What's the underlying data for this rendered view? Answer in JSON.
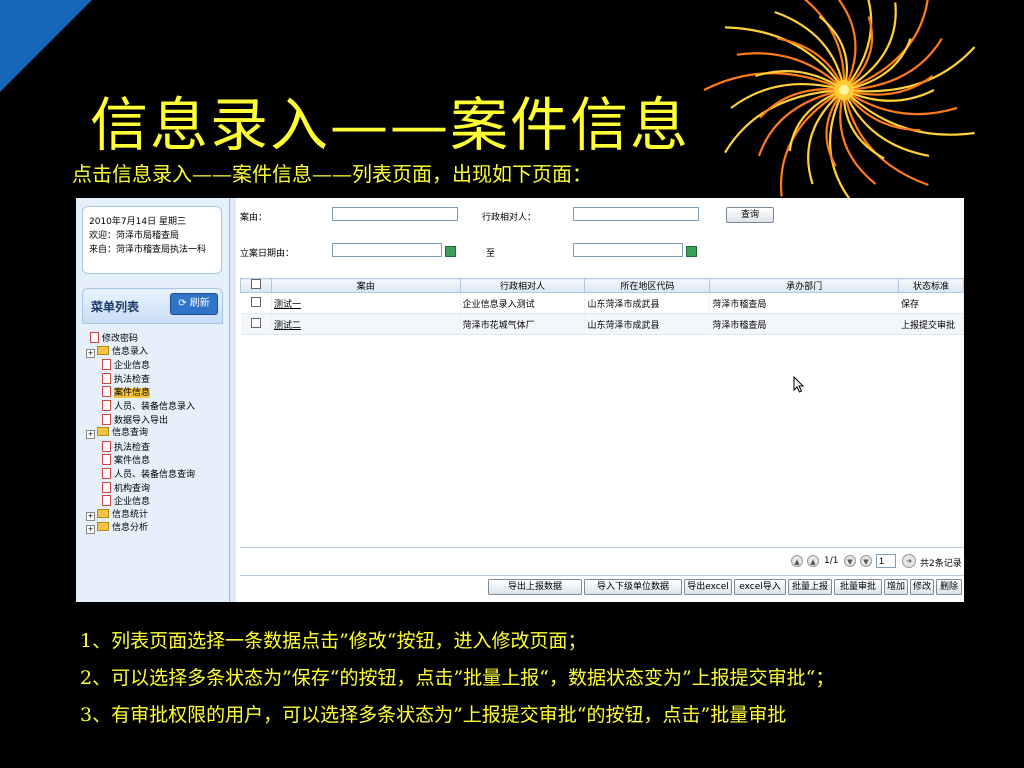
{
  "slide": {
    "title": "信息录入——案件信息",
    "subtitle": "点击信息录入——案件信息——列表页面，出现如下页面："
  },
  "app": {
    "user": {
      "date": "2010年7月14日 星期三",
      "welcome": "欢迎：菏泽市局稽查局",
      "from": "来自：菏泽市稽查局执法一科"
    },
    "menu": {
      "title": "菜单列表",
      "refresh_label": "刷新",
      "items": [
        {
          "label": "修改密码",
          "type": "file",
          "level": 1
        },
        {
          "label": "信息录入",
          "type": "folder",
          "level": 0
        },
        {
          "label": "企业信息",
          "type": "file",
          "level": 2
        },
        {
          "label": "执法检查",
          "type": "file",
          "level": 2
        },
        {
          "label": "案件信息",
          "type": "file",
          "level": 2,
          "selected": true
        },
        {
          "label": "人员、装备信息录入",
          "type": "file",
          "level": 2
        },
        {
          "label": "数据导入导出",
          "type": "file",
          "level": 2
        },
        {
          "label": "信息查询",
          "type": "folder",
          "level": 0
        },
        {
          "label": "执法检查",
          "type": "file",
          "level": 2
        },
        {
          "label": "案件信息",
          "type": "file",
          "level": 2
        },
        {
          "label": "人员、装备信息查询",
          "type": "file",
          "level": 2
        },
        {
          "label": "机构查询",
          "type": "file",
          "level": 2
        },
        {
          "label": "企业信息",
          "type": "file",
          "level": 2
        },
        {
          "label": "信息统计",
          "type": "folder",
          "level": 0
        },
        {
          "label": "信息分析",
          "type": "folder",
          "level": 0
        }
      ]
    },
    "search": {
      "case_label": "案由：",
      "party_label": "行政相对人：",
      "date_label": "立案日期由：",
      "to_label": "至",
      "query_button": "查询",
      "case_value": "",
      "party_value": "",
      "date_from": "",
      "date_to": ""
    },
    "table": {
      "headers": [
        "案由",
        "行政相对人",
        "所在地区代码",
        "承办部门",
        "状态标准"
      ],
      "rows": [
        {
          "case": "测试一",
          "party": "企业信息录入测试",
          "region": "山东菏泽市成武县",
          "dept": "菏泽市稽查局",
          "status": "保存"
        },
        {
          "case": "测试二",
          "party": "菏泽市花城气体厂",
          "region": "山东菏泽市成武县",
          "dept": "菏泽市稽查局",
          "status": "上报提交审批"
        }
      ]
    },
    "pager": {
      "page_info": "1/1",
      "page_input": "1",
      "total": "共2条记录"
    },
    "actions": [
      "导出上报数据",
      "导入下级单位数据",
      "导出excel",
      "excel导入",
      "批量上报",
      "批量审批",
      "增加",
      "修改",
      "删除"
    ]
  },
  "notes": [
    "1、列表页面选择一条数据点击”修改“按钮，进入修改页面；",
    "2、可以选择多条状态为”保存“的按钮，点击”批量上报“，数据状态变为”上报提交审批“；",
    "3、有审批权限的用户，可以选择多条状态为”上报提交审批“的按钮，点击”批量审批"
  ]
}
